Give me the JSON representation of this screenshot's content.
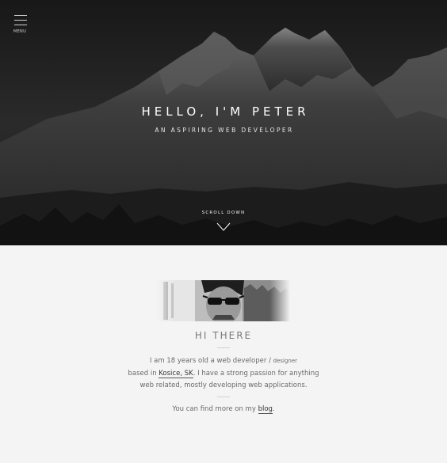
{
  "nav": {
    "menu_label": "MENU"
  },
  "hero": {
    "title": "HELLO, I'M PETER",
    "subtitle": "AN ASPIRING WEB DEVELOPER",
    "scroll_label": "SCROLL DOWN"
  },
  "about": {
    "title": "HI THERE",
    "line1_text": "I am 18 years old a web developer / ",
    "line1_small": "designer",
    "line2_prefix": "based in ",
    "location_link": "Kosice, SK",
    "line2_suffix": ". I have a strong passion for anything",
    "line3": "web related, mostly developing web applications.",
    "more_prefix": "You can find more on my ",
    "blog_link": "blog",
    "more_suffix": "."
  },
  "colors": {
    "hero_bg": "#1c1c1c",
    "page_bg": "#f4f4f4",
    "text": "#6a6a6a"
  }
}
